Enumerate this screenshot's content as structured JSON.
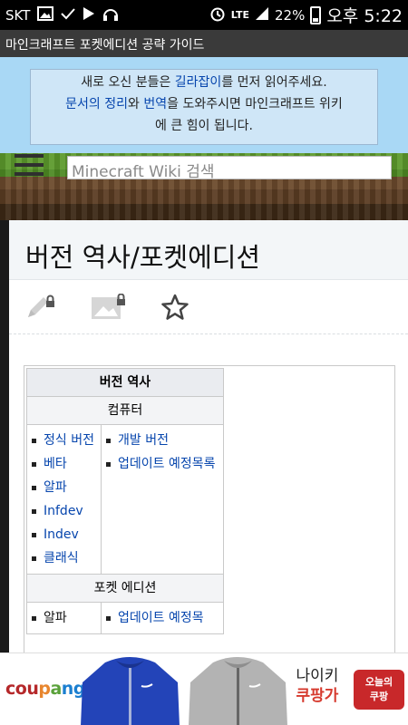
{
  "status_bar": {
    "carrier": "SKT",
    "battery": "22%",
    "network": "LTE",
    "time": "오후 5:22",
    "icons": [
      "gallery-icon",
      "check-icon",
      "play-icon",
      "headset-icon",
      "alarm-icon",
      "signal-icon",
      "battery-icon"
    ]
  },
  "app_title": "마인크래프트 포켓에디션 공략 가이드",
  "notice": {
    "line1_pre": "새로 오신 분들은 ",
    "line1_link": "길라잡이",
    "line1_post": "를 먼저 읽어주세요.",
    "line2_link1": "문서의 정리",
    "line2_mid": "와 ",
    "line2_link2": "번역",
    "line2_post": "을 도와주시면 마인크래프트 위키",
    "line3": "에 큰 힘이 됩니다."
  },
  "search": {
    "placeholder": "Minecraft Wiki 검색"
  },
  "page": {
    "title": "버전 역사/포켓에디션"
  },
  "navbox": {
    "title": "버전 역사",
    "section1": "컴퓨터",
    "col1": [
      "정식 버전",
      "베타",
      "알파",
      "Infdev",
      "Indev",
      "클래식"
    ],
    "col2": [
      "개발 버전",
      "업데이트 예정목록"
    ],
    "section2": "포켓 에디션",
    "col3": [
      "알파"
    ],
    "col4": [
      "업데이트 예정목"
    ]
  },
  "ad": {
    "logo": [
      "cou",
      "p",
      "a",
      "ng"
    ],
    "brand": "나이키",
    "store": "쿠팡가",
    "badge_line1": "오늘의",
    "badge_line2": "쿠팡"
  },
  "colors": {
    "link": "#0645ad",
    "sky": "#a9d8f5",
    "notice_bg": "#cfe6f7"
  }
}
